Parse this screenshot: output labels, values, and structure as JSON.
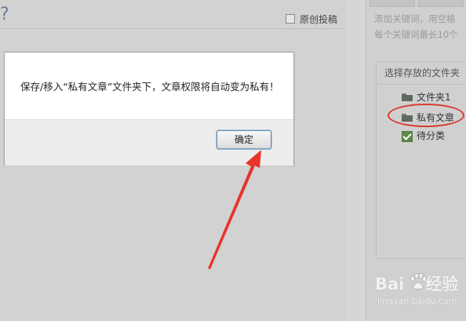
{
  "header": {
    "qmark": "?",
    "original_label": "原创投稿"
  },
  "tags": {
    "hint_lines": [
      "添加关键词，用空格",
      "每个关键词最长10个"
    ]
  },
  "folder_panel": {
    "title": "选择存放的文件夹",
    "items": [
      {
        "label": "文件夹1",
        "icon": "folder-icon"
      },
      {
        "label": "私有文章",
        "icon": "folder-icon"
      },
      {
        "label": "待分类",
        "icon": "check-icon"
      }
    ]
  },
  "dialog": {
    "message": "保存/移入“私有文章”文件夹下，文章权限将自动变为私有！",
    "ok_label": "确定"
  },
  "watermark": {
    "logo_left": "Bai",
    "logo_right": "经验",
    "url": "jingyan.baidu.com"
  },
  "colors": {
    "annotation_red": "#e8332a",
    "overlay_gray": "#d2d2d2",
    "button_border": "#6d8fb0"
  }
}
